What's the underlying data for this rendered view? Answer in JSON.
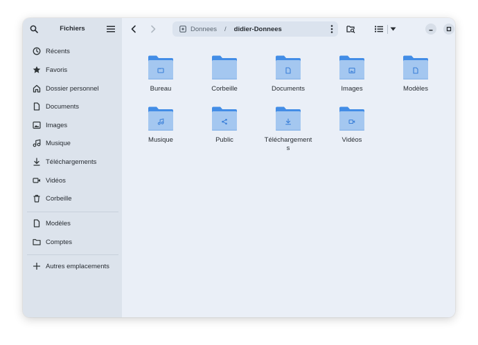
{
  "sidebar": {
    "title": "Fichiers",
    "items": [
      {
        "label": "Récents",
        "icon": "clock-icon"
      },
      {
        "label": "Favoris",
        "icon": "star-icon"
      },
      {
        "label": "Dossier personnel",
        "icon": "home-icon"
      },
      {
        "label": "Documents",
        "icon": "document-icon"
      },
      {
        "label": "Images",
        "icon": "image-icon"
      },
      {
        "label": "Musique",
        "icon": "music-icon"
      },
      {
        "label": "Téléchargements",
        "icon": "download-icon"
      },
      {
        "label": "Vidéos",
        "icon": "video-icon"
      },
      {
        "label": "Corbeille",
        "icon": "trash-icon"
      }
    ],
    "bookmarks": [
      {
        "label": "Modèles",
        "icon": "document-icon"
      },
      {
        "label": "Comptes",
        "icon": "folder-icon"
      }
    ],
    "other_locations": {
      "label": "Autres emplacements",
      "icon": "plus-icon"
    }
  },
  "pathbar": {
    "parent": "Donnees",
    "separator": "/",
    "current": "didier-Donnees"
  },
  "folders": [
    {
      "name": "Bureau",
      "emblem": "folder"
    },
    {
      "name": "Corbeille",
      "emblem": "none"
    },
    {
      "name": "Documents",
      "emblem": "document"
    },
    {
      "name": "Images",
      "emblem": "image"
    },
    {
      "name": "Modèles",
      "emblem": "document"
    },
    {
      "name": "Musique",
      "emblem": "music"
    },
    {
      "name": "Public",
      "emblem": "share"
    },
    {
      "name": "Téléchargements",
      "emblem": "download"
    },
    {
      "name": "Vidéos",
      "emblem": "video"
    }
  ],
  "colors": {
    "sidebar_bg": "#dce3ec",
    "content_bg": "#eaeff7",
    "folder_back": "#438de6",
    "folder_front": "#a4c7f0",
    "emblem": "#3a7fd8"
  }
}
